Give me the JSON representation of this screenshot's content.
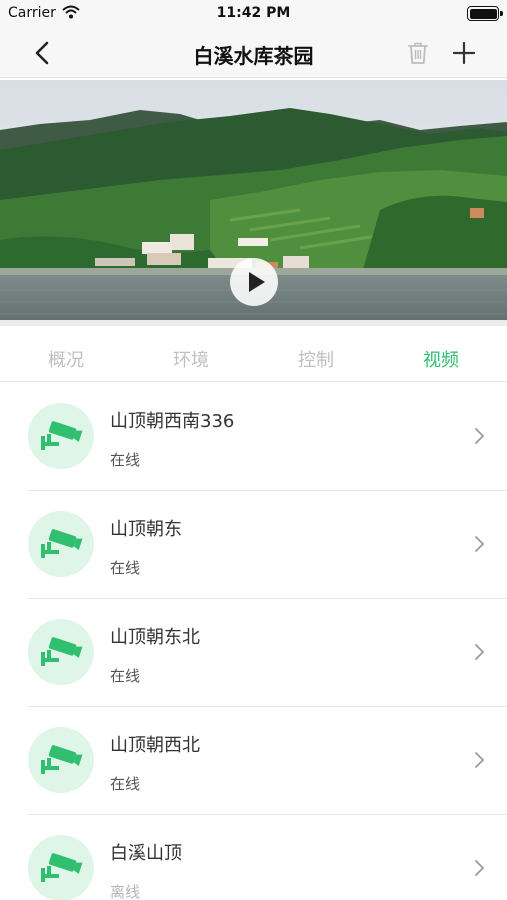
{
  "status_bar": {
    "carrier": "Carrier",
    "time": "11:42 PM"
  },
  "nav": {
    "title": "白溪水库茶园"
  },
  "tabs": [
    {
      "label": "概况",
      "active": false
    },
    {
      "label": "环境",
      "active": false
    },
    {
      "label": "控制",
      "active": false
    },
    {
      "label": "视频",
      "active": true
    }
  ],
  "cameras": [
    {
      "name": "山顶朝西南336",
      "status": "在线",
      "online": true
    },
    {
      "name": "山顶朝东",
      "status": "在线",
      "online": true
    },
    {
      "name": "山顶朝东北",
      "status": "在线",
      "online": true
    },
    {
      "name": "山顶朝西北",
      "status": "在线",
      "online": true
    },
    {
      "name": "白溪山顶",
      "status": "离线",
      "online": false
    }
  ],
  "icons": {
    "back": "chevron-left-icon",
    "trash": "trash-icon",
    "add": "plus-icon",
    "play": "play-icon",
    "camera": "camera-icon",
    "row_arrow": "chevron-right-icon"
  },
  "colors": {
    "accent": "#2fbf6f",
    "inactive_tab": "#c0c0c0",
    "avatar_bg": "#dff5e8",
    "offline": "#b5b5b5"
  }
}
